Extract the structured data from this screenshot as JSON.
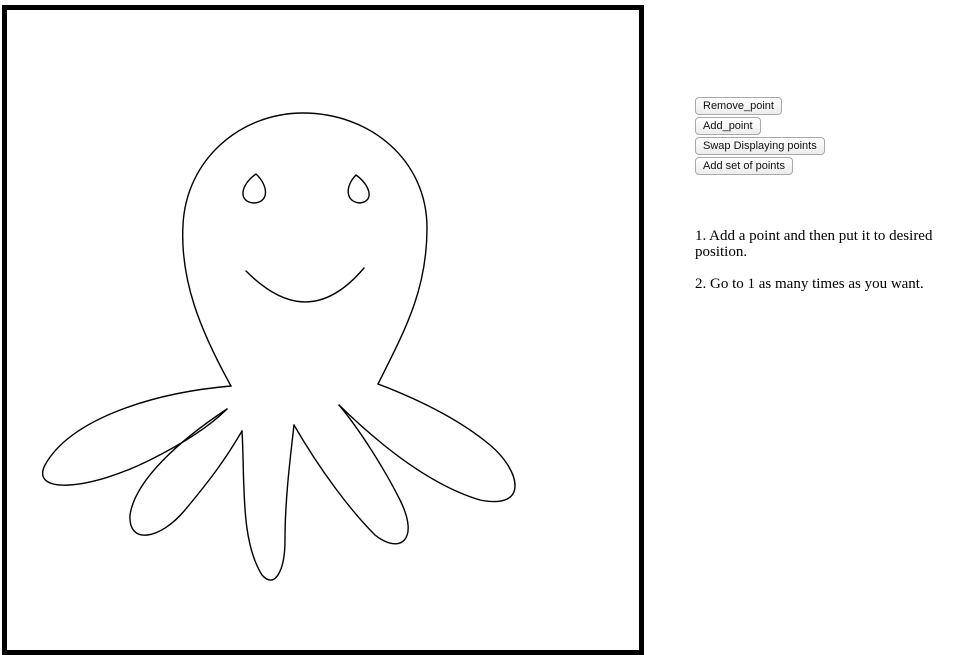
{
  "toolbar": {
    "buttons": [
      {
        "label": "Remove_point"
      },
      {
        "label": "Add_point"
      },
      {
        "label": "Swap Displaying points"
      },
      {
        "label": "Add set of points"
      }
    ]
  },
  "instructions": {
    "steps": [
      "1. Add a point and then put it to desired position.",
      "2. Go to 1 as many times as you want."
    ]
  },
  "colors": {
    "frame": "#000000",
    "stroke": "#000000",
    "background": "#ffffff"
  }
}
